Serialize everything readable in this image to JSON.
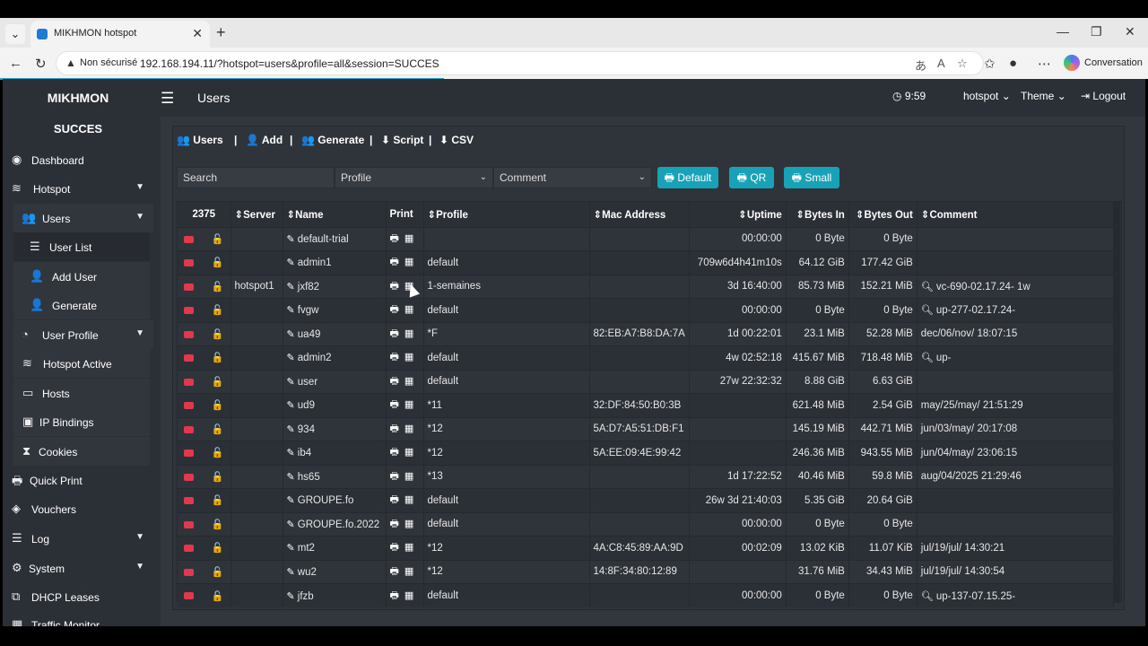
{
  "browser": {
    "tab_title": "MIKHMON hotspot",
    "security_label": "Non sécurisé",
    "url": "192.168.194.11/?hotspot=users&profile=all&session=SUCCES",
    "conversation_label": "Conversation"
  },
  "app": {
    "brand": "MIKHMON",
    "page_title": "Users",
    "clock": "9:59",
    "hotspot_menu": "hotspot",
    "theme_menu": "Theme",
    "logout": "Logout",
    "session": "SUCCES"
  },
  "sidebar": {
    "items": [
      {
        "label": "Dashboard"
      },
      {
        "label": "Hotspot"
      },
      {
        "label": "Users"
      },
      {
        "label": "User List"
      },
      {
        "label": "Add User"
      },
      {
        "label": "Generate"
      },
      {
        "label": "User Profile"
      },
      {
        "label": "Hotspot Active"
      },
      {
        "label": "Hosts"
      },
      {
        "label": "IP Bindings"
      },
      {
        "label": "Cookies"
      },
      {
        "label": "Quick Print"
      },
      {
        "label": "Vouchers"
      },
      {
        "label": "Log"
      },
      {
        "label": "System"
      },
      {
        "label": "DHCP Leases"
      },
      {
        "label": "Traffic Monitor"
      }
    ]
  },
  "toolbar": {
    "users": "Users",
    "add": "Add",
    "generate": "Generate",
    "script": "Script",
    "csv": "CSV",
    "sep": "|"
  },
  "filters": {
    "search_placeholder": "Search",
    "profile": "Profile",
    "comment": "Comment",
    "btn_default": "Default",
    "btn_qr": "QR",
    "btn_small": "Small"
  },
  "table": {
    "count": "2375",
    "headers": [
      "Server",
      "Name",
      "Print",
      "Profile",
      "Mac Address",
      "Uptime",
      "Bytes In",
      "Bytes Out",
      "Comment"
    ],
    "rows": [
      {
        "server": "",
        "name": "default-trial",
        "profile": "",
        "mac": "",
        "uptime": "00:00:00",
        "bin": "0 Byte",
        "bout": "0 Byte",
        "comment": "",
        "cicon": false
      },
      {
        "server": "",
        "name": "admin1",
        "profile": "default",
        "mac": "",
        "uptime": "709w6d4h41m10s",
        "bin": "64.12 GiB",
        "bout": "177.42 GiB",
        "comment": "",
        "cicon": false
      },
      {
        "server": "hotspot1",
        "name": "jxf82",
        "profile": "1-semaines",
        "mac": "",
        "uptime": "3d 16:40:00",
        "bin": "85.73 MiB",
        "bout": "152.21 MiB",
        "comment": "vc-690-02.17.24- 1w",
        "cicon": true
      },
      {
        "server": "",
        "name": "fvgw",
        "profile": "default",
        "mac": "",
        "uptime": "00:00:00",
        "bin": "0 Byte",
        "bout": "0 Byte",
        "comment": "up-277-02.17.24-",
        "cicon": true
      },
      {
        "server": "",
        "name": "ua49",
        "profile": "*F",
        "mac": "82:EB:A7:B8:DA:7A",
        "uptime": "1d 00:22:01",
        "bin": "23.1 MiB",
        "bout": "52.28 MiB",
        "comment": "dec/06/nov/ 18:07:15",
        "cicon": false
      },
      {
        "server": "",
        "name": "admin2",
        "profile": "default",
        "mac": "",
        "uptime": "4w 02:52:18",
        "bin": "415.67 MiB",
        "bout": "718.48 MiB",
        "comment": "up-",
        "cicon": true
      },
      {
        "server": "",
        "name": "user",
        "profile": "default",
        "mac": "",
        "uptime": "27w 22:32:32",
        "bin": "8.88 GiB",
        "bout": "6.63 GiB",
        "comment": "",
        "cicon": false
      },
      {
        "server": "",
        "name": "ud9",
        "profile": "*11",
        "mac": "32:DF:84:50:B0:3B",
        "uptime": "",
        "bin": "621.48 MiB",
        "bout": "2.54 GiB",
        "comment": "may/25/may/ 21:51:29",
        "cicon": false
      },
      {
        "server": "",
        "name": "934",
        "profile": "*12",
        "mac": "5A:D7:A5:51:DB:F1",
        "uptime": "",
        "bin": "145.19 MiB",
        "bout": "442.71 MiB",
        "comment": "jun/03/may/ 20:17:08",
        "cicon": false
      },
      {
        "server": "",
        "name": "ib4",
        "profile": "*12",
        "mac": "5A:EE:09:4E:99:42",
        "uptime": "",
        "bin": "246.36 MiB",
        "bout": "943.55 MiB",
        "comment": "jun/04/may/ 23:06:15",
        "cicon": false
      },
      {
        "server": "",
        "name": "hs65",
        "profile": "*13",
        "mac": "",
        "uptime": "1d 17:22:52",
        "bin": "40.46 MiB",
        "bout": "59.8 MiB",
        "comment": "aug/04/2025 21:29:46",
        "cicon": false
      },
      {
        "server": "",
        "name": "GROUPE.fo",
        "profile": "default",
        "mac": "",
        "uptime": "26w 3d 21:40:03",
        "bin": "5.35 GiB",
        "bout": "20.64 GiB",
        "comment": "",
        "cicon": false
      },
      {
        "server": "",
        "name": "GROUPE.fo.2022",
        "profile": "default",
        "mac": "",
        "uptime": "00:00:00",
        "bin": "0 Byte",
        "bout": "0 Byte",
        "comment": "",
        "cicon": false
      },
      {
        "server": "",
        "name": "mt2",
        "profile": "*12",
        "mac": "4A:C8:45:89:AA:9D",
        "uptime": "00:02:09",
        "bin": "13.02 KiB",
        "bout": "11.07 KiB",
        "comment": "jul/19/jul/ 14:30:21",
        "cicon": false
      },
      {
        "server": "",
        "name": "wu2",
        "profile": "*12",
        "mac": "14:8F:34:80:12:89",
        "uptime": "",
        "bin": "31.76 MiB",
        "bout": "34.43 MiB",
        "comment": "jul/19/jul/ 14:30:54",
        "cicon": false
      },
      {
        "server": "",
        "name": "jfzb",
        "profile": "default",
        "mac": "",
        "uptime": "00:00:00",
        "bin": "0 Byte",
        "bout": "0 Byte",
        "comment": "up-137-07.15.25-",
        "cicon": true
      }
    ]
  },
  "colors": {
    "accent": "#17a2b8",
    "danger": "#e0384d",
    "bg": "#2b3037"
  }
}
